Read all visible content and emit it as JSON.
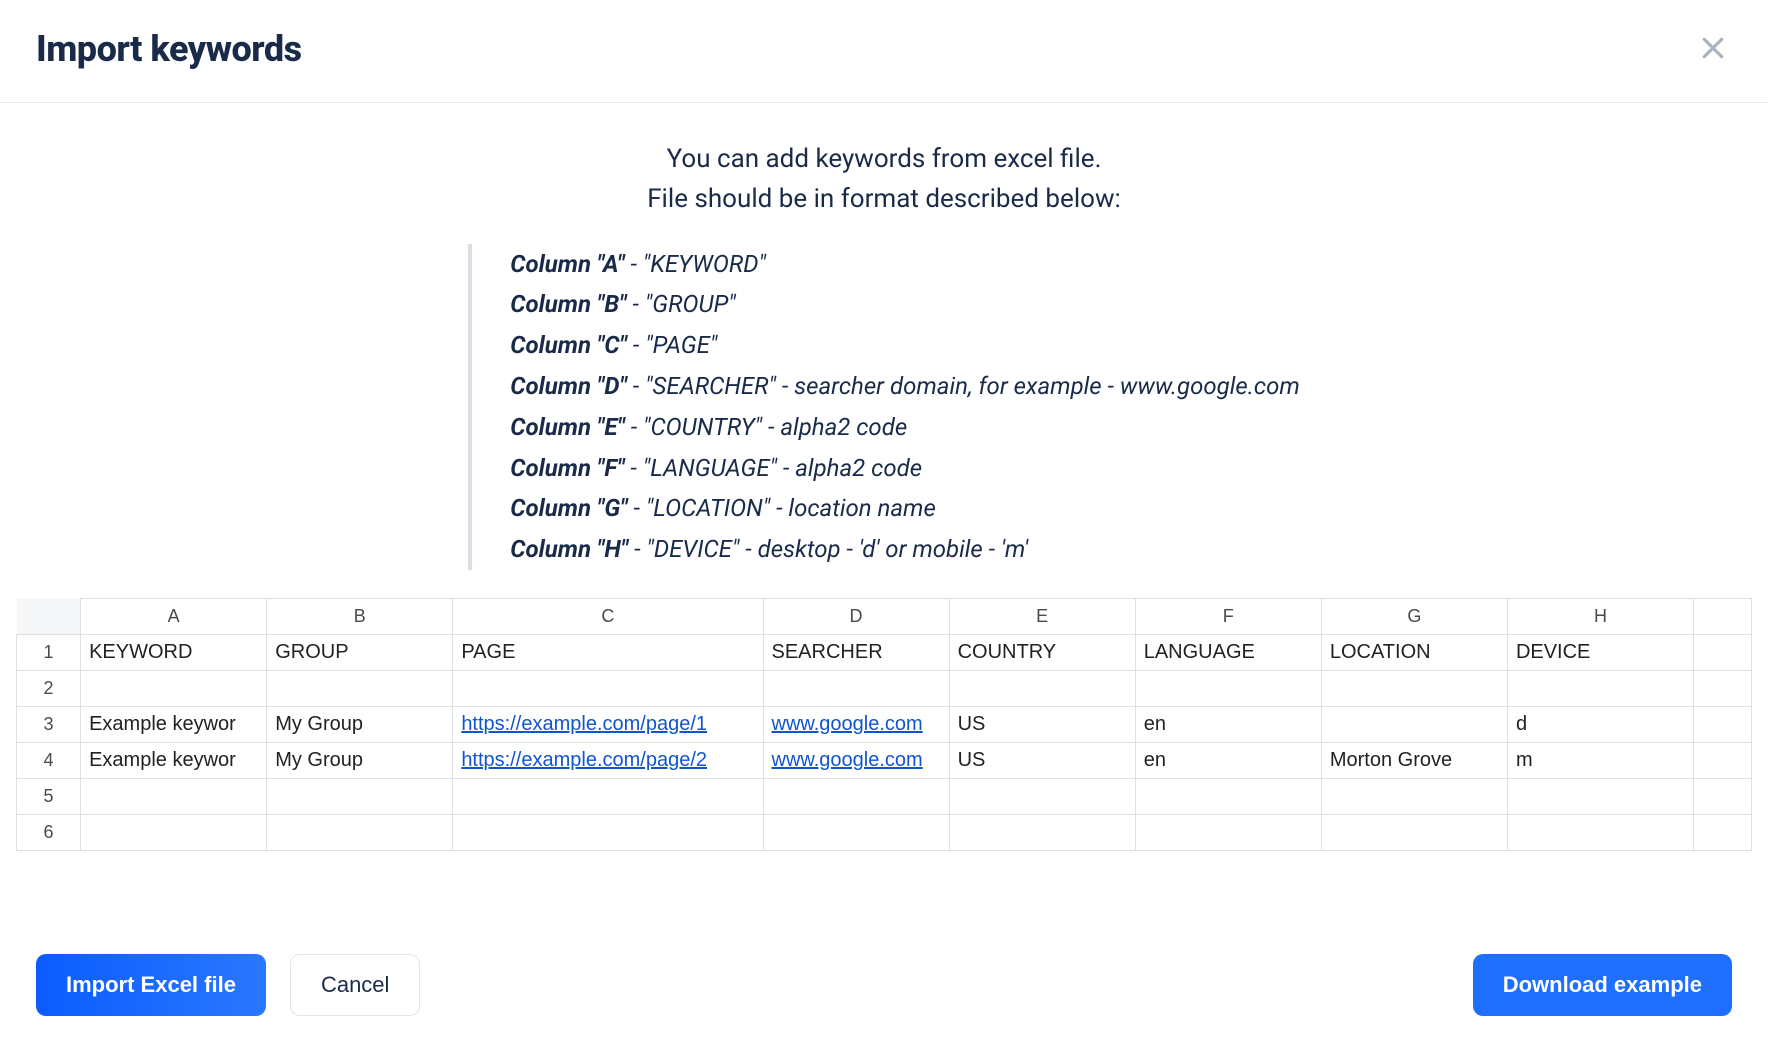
{
  "header": {
    "title": "Import keywords"
  },
  "intro": {
    "line1": "You can add keywords from excel file.",
    "line2": "File should be in format described below:"
  },
  "spec": [
    {
      "col": "Column \"A\"",
      "rest": " - \"KEYWORD\""
    },
    {
      "col": "Column \"B\"",
      "rest": " - \"GROUP\""
    },
    {
      "col": "Column \"C\"",
      "rest": " - \"PAGE\""
    },
    {
      "col": "Column \"D\"",
      "rest": " - \"SEARCHER\" - searcher domain, for example - www.google.com"
    },
    {
      "col": "Column \"E\"",
      "rest": " - \"COUNTRY\" - alpha2 code"
    },
    {
      "col": "Column \"F\"",
      "rest": " - \"LANGUAGE\" - alpha2 code"
    },
    {
      "col": "Column \"G\"",
      "rest": " - \"LOCATION\" - location name"
    },
    {
      "col": "Column \"H\"",
      "rest": " - \"DEVICE\" - desktop - 'd' or mobile - 'm'"
    }
  ],
  "spreadsheet": {
    "columns": [
      "A",
      "B",
      "C",
      "D",
      "E",
      "F",
      "G",
      "H"
    ],
    "headerRow": [
      "KEYWORD",
      "GROUP",
      "PAGE",
      "SEARCHER",
      "COUNTRY",
      "LANGUAGE",
      "LOCATION",
      "DEVICE"
    ],
    "rows": [
      {
        "num": "1",
        "cells": [
          "KEYWORD",
          "GROUP",
          "PAGE",
          "SEARCHER",
          "COUNTRY",
          "LANGUAGE",
          "LOCATION",
          "DEVICE"
        ],
        "link": [
          false,
          false,
          false,
          false,
          false,
          false,
          false,
          false
        ]
      },
      {
        "num": "2",
        "cells": [
          "",
          "",
          "",
          "",
          "",
          "",
          "",
          ""
        ],
        "link": [
          false,
          false,
          false,
          false,
          false,
          false,
          false,
          false
        ]
      },
      {
        "num": "3",
        "cells": [
          "Example keywor",
          "My Group",
          "https://example.com/page/1",
          "www.google.com",
          "US",
          "en",
          "",
          "d"
        ],
        "link": [
          false,
          false,
          true,
          true,
          false,
          false,
          false,
          false
        ]
      },
      {
        "num": "4",
        "cells": [
          "Example keywor",
          "My Group",
          "https://example.com/page/2",
          "www.google.com",
          "US",
          "en",
          "Morton Grove",
          "m"
        ],
        "link": [
          false,
          false,
          true,
          true,
          false,
          false,
          false,
          false
        ]
      },
      {
        "num": "5",
        "cells": [
          "",
          "",
          "",
          "",
          "",
          "",
          "",
          ""
        ],
        "link": [
          false,
          false,
          false,
          false,
          false,
          false,
          false,
          false
        ]
      },
      {
        "num": "6",
        "cells": [
          "",
          "",
          "",
          "",
          "",
          "",
          "",
          ""
        ],
        "link": [
          false,
          false,
          false,
          false,
          false,
          false,
          false,
          false
        ]
      }
    ]
  },
  "actions": {
    "import_label": "Import Excel file",
    "cancel_label": "Cancel",
    "download_label": "Download example"
  }
}
